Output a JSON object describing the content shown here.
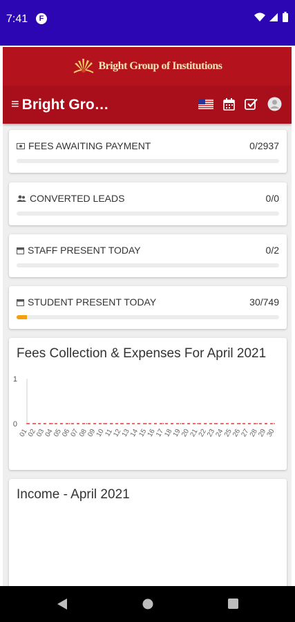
{
  "status_bar": {
    "time": "7:41",
    "app_icon_glyph": "F"
  },
  "header": {
    "brand_name": "Bright Group of Institutions",
    "title": "Bright Gro…",
    "menu_glyph": "≡",
    "icons": [
      "us-flag-icon",
      "calendar-icon",
      "checkbox-icon",
      "profile-icon"
    ]
  },
  "stats": [
    {
      "label": "FEES AWAITING PAYMENT",
      "value": "0/2937",
      "icon": "money-icon",
      "progress": 0.0
    },
    {
      "label": "CONVERTED LEADS",
      "value": "0/0",
      "icon": "users-icon",
      "progress": 0.0
    },
    {
      "label": "STAFF PRESENT TODAY",
      "value": "0/2",
      "icon": "calendar-icon",
      "progress": 0.0
    },
    {
      "label": "STUDENT PRESENT TODAY",
      "value": "30/749",
      "icon": "calendar-icon",
      "progress": 0.04
    }
  ],
  "fees_chart": {
    "title": "Fees Collection & Expenses For April 2021"
  },
  "income_chart": {
    "title": "Income - April 2021"
  },
  "colors": {
    "status_bar": "#2d06b3",
    "brand_bar": "#b4121d",
    "toolbar": "#a80f1a",
    "progress": "#f2a10d",
    "chart_line": "#e53935"
  },
  "chart_data": {
    "type": "line",
    "title": "Fees Collection & Expenses For April 2021",
    "categories": [
      "01",
      "02",
      "03",
      "04",
      "05",
      "06",
      "07",
      "08",
      "09",
      "10",
      "11",
      "12",
      "13",
      "14",
      "15",
      "16",
      "17",
      "18",
      "19",
      "20",
      "21",
      "22",
      "23",
      "24",
      "25",
      "26",
      "27",
      "28",
      "29",
      "30"
    ],
    "series": [
      {
        "values": [
          0,
          0,
          0,
          0,
          0,
          0,
          0,
          0,
          0,
          0,
          0,
          0,
          0,
          0,
          0,
          0,
          0,
          0,
          0,
          0,
          0,
          0,
          0,
          0,
          0,
          0,
          0,
          0,
          0,
          0
        ]
      }
    ],
    "yticks": [
      "0",
      "1"
    ],
    "ylim": [
      0,
      1
    ],
    "grid": false
  }
}
